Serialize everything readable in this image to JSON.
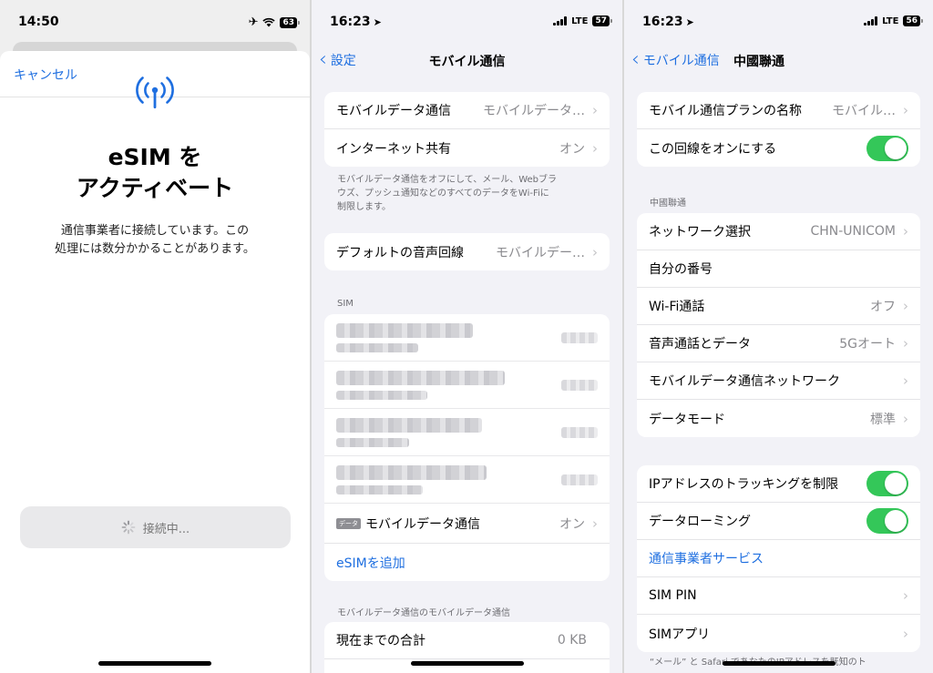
{
  "panel1": {
    "time": "14:50",
    "battery": "63",
    "cancel": "キャンセル",
    "title_line1": "eSIM を",
    "title_line2": "アクティベート",
    "desc_line1": "通信事業者に接続しています。この",
    "desc_line2": "処理には数分かかることがあります。",
    "button_label": "接続中...",
    "accent": "#1f6fe0"
  },
  "panel2": {
    "time": "16:23",
    "network": "LTE",
    "battery": "57",
    "back_label": "設定",
    "title": "モバイル通信",
    "group1": [
      {
        "label": "モバイルデータ通信",
        "value": "モバイルデータ…"
      },
      {
        "label": "インターネット共有",
        "value": "オン"
      }
    ],
    "footnote1_line1": "モバイルデータ通信をオフにして、メール、Webブラ",
    "footnote1_line2": "ウズ、プッシュ通知などのすべてのデータをWi-Fiに",
    "footnote1_line3": "制限します。",
    "default_voice": {
      "label": "デフォルトの音声回線",
      "value": "モバイルデー…"
    },
    "sim_header": "SIM",
    "data_badge": "データ",
    "data_row": {
      "label": "モバイルデータ通信",
      "value": "オン"
    },
    "add_esim": "eSIMを追加",
    "usage_header": "モバイルデータ通信のモバイルデータ通信",
    "usage_row": {
      "label": "現在までの合計",
      "value": "0 KB"
    }
  },
  "panel3": {
    "time": "16:23",
    "network": "LTE",
    "battery": "56",
    "back_label": "モバイル通信",
    "title": "中國聯通",
    "plan_row": {
      "label": "モバイル通信プランの名称",
      "value": "モバイル…"
    },
    "line_on_label": "この回線をオンにする",
    "section_header": "中國聯通",
    "group2": [
      {
        "label": "ネットワーク選択",
        "value": "CHN-UNICOM"
      },
      {
        "label": "自分の番号",
        "value": ""
      },
      {
        "label": "Wi-Fi通話",
        "value": "オフ"
      },
      {
        "label": "音声通話とデータ",
        "value": "5Gオート"
      },
      {
        "label": "モバイルデータ通信ネットワーク",
        "value": ""
      },
      {
        "label": "データモード",
        "value": "標準"
      }
    ],
    "ip_tracking_label": "IPアドレスのトラッキングを制限",
    "roaming_label": "データローミング",
    "carrier_services": "通信事業者サービス",
    "sim_pin": "SIM PIN",
    "sim_app": "SIMアプリ",
    "footnote": "“メール” と Safari であなたのIPアドレスを既知のト",
    "toggle_color": "#34c759"
  }
}
